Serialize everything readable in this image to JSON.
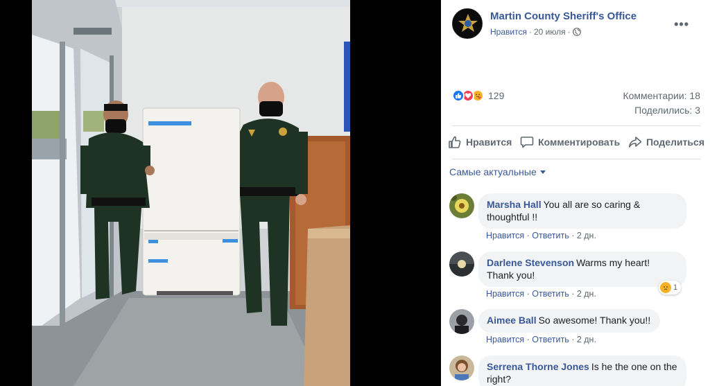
{
  "post": {
    "page_name": "Martin County Sheriff's Office",
    "like_link": "Нравится",
    "date": "20 июля",
    "separator": "·",
    "reaction_count": "129",
    "comments_stat": "Комментарии: 18",
    "shares_stat": "Поделились: 3"
  },
  "actions": {
    "like": "Нравится",
    "comment": "Комментировать",
    "share": "Поделиться"
  },
  "sort": {
    "label": "Самые актуальные"
  },
  "comments": [
    {
      "author": "Marsha Hall",
      "text": "You all are so caring & thoughtful !!",
      "like": "Нравится",
      "reply": "Ответить",
      "time": "2 дн."
    },
    {
      "author": "Darlene Stevenson",
      "text": "Warms my heart! Thank you!",
      "like": "Нравится",
      "reply": "Ответить",
      "time": "2 дн.",
      "reaction_count": "1"
    },
    {
      "author": "Aimee Ball",
      "text": "So awesome! Thank you!!",
      "like": "Нравится",
      "reply": "Ответить",
      "time": "2 дн."
    },
    {
      "author": "Serrena Thorne Jones",
      "text": "Is he the one on the right?"
    }
  ],
  "colors": {
    "link_blue": "#385898",
    "like_blue": "#1877f2",
    "love_red": "#f33e58",
    "care_yellow": "#f7b125",
    "uniform_green": "#1f3324"
  }
}
